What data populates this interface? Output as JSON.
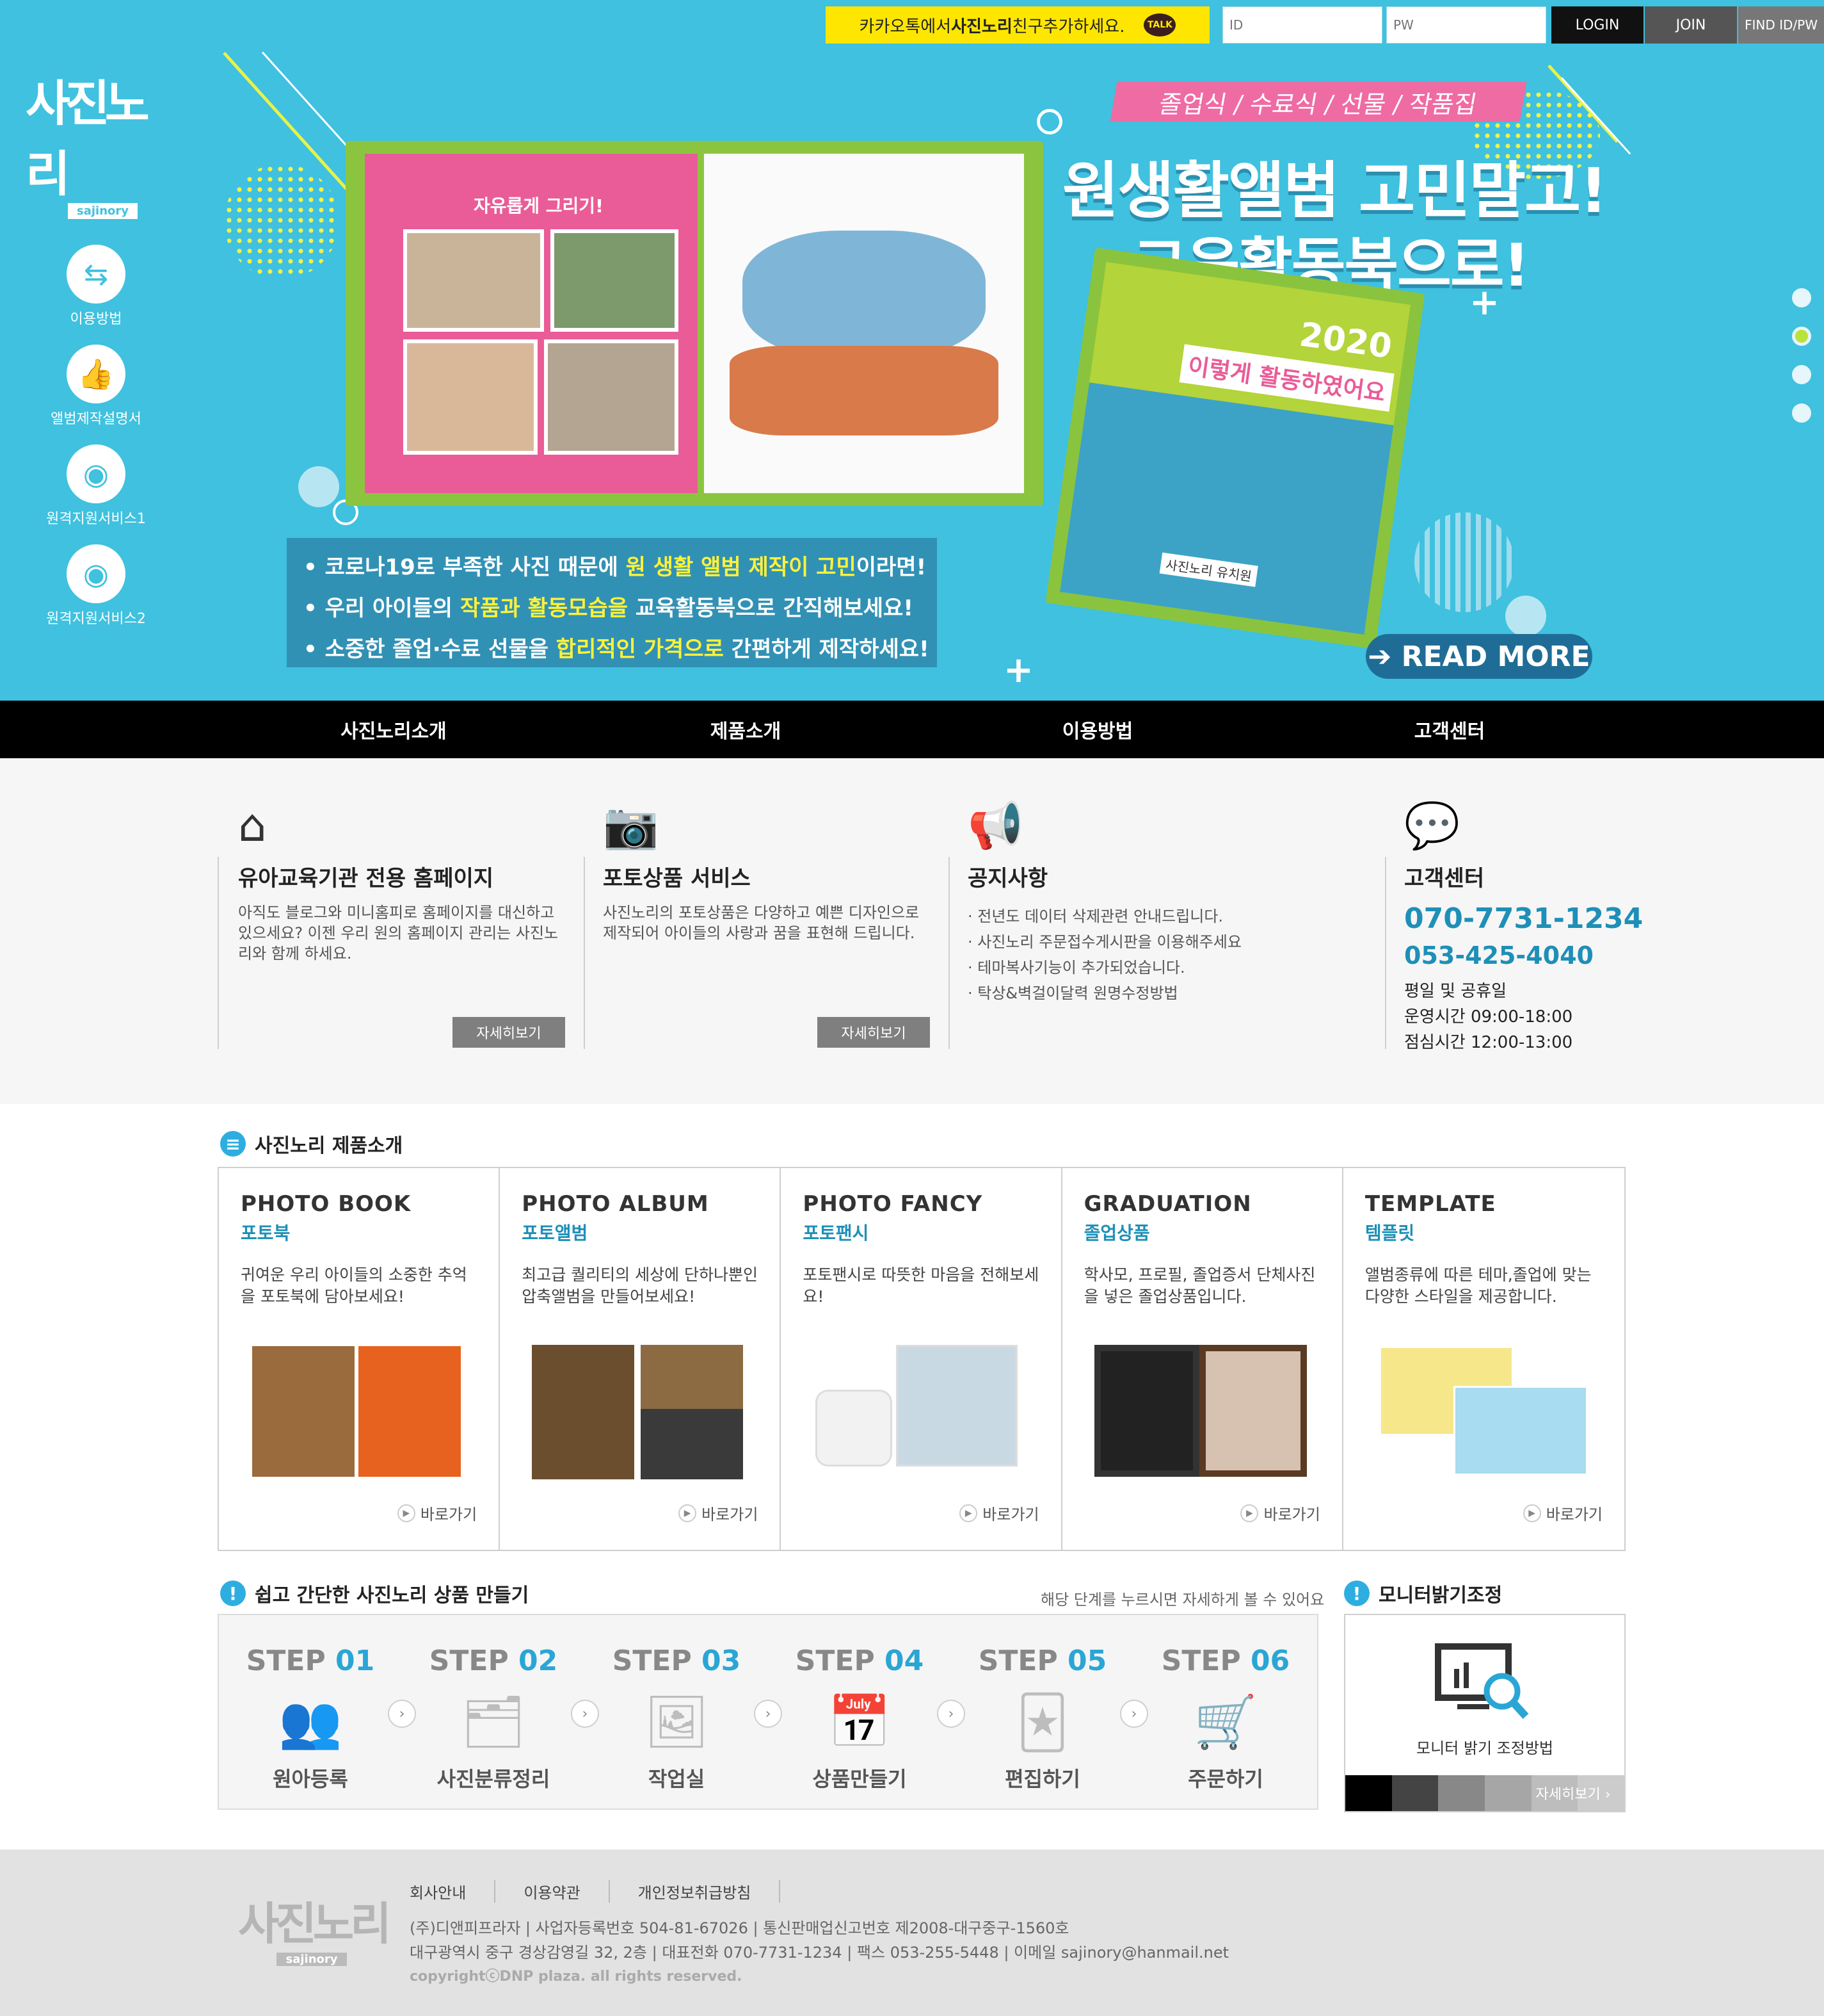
{
  "top": {
    "kakao_pre": "카카오톡에서 ",
    "kakao_brand": "사진노리",
    "kakao_post": " 친구추가하세요.",
    "kakao_badge": "TALK",
    "id_placeholder": "ID",
    "pw_placeholder": "PW",
    "login_label": "LOGIN",
    "join_label": "JOIN",
    "find_label": "FIND ID/PW"
  },
  "logo": {
    "main": "사진노리",
    "sub": "sajinory"
  },
  "sidebar": {
    "items": [
      {
        "label": "이용방법",
        "icon": "signpost-icon"
      },
      {
        "label": "앨범제작설명서",
        "icon": "thumbs-up-icon"
      },
      {
        "label": "원격지원서비스1",
        "icon": "monitor-eye-icon"
      },
      {
        "label": "원격지원서비스2",
        "icon": "monitor-eye-icon"
      }
    ]
  },
  "banner": {
    "ribbon": "졸업식 / 수료식 / 선물 / 작품집",
    "headline1": "원생활앨범 고민말고!",
    "headline2": "교육활동북으로!",
    "book_page_title": "자유롭게 그리기!",
    "product_year": "2020",
    "product_title": "이렇게 활동하였어요",
    "product_school": "사진노리 유치원",
    "bullets": [
      {
        "pre": "• 코로나19로 부족한 사진 때문에 ",
        "hl": "원 생활 앨범 제작이 고민",
        "post": "이라면!"
      },
      {
        "pre": "• 우리 아이들의 ",
        "hl": "작품과 활동모습을",
        "post": " 교육활동북으로 간직해보세요!"
      },
      {
        "pre": "• 소중한 졸업·수료 선물을 ",
        "hl": "합리적인 가격으로",
        "post": " 간편하게 제작하세요!"
      }
    ],
    "read_more": "➔ READ MORE"
  },
  "nav": [
    "사진노리소개",
    "제품소개",
    "이용방법",
    "고객센터"
  ],
  "info": {
    "homepage": {
      "title": "유아교육기관 전용 홈페이지",
      "desc": "아직도 블로그와 미니홈피로 홈페이지를 대신하고 있으세요? 이젠 우리 원의 홈페이지 관리는 사진노리와 함께 하세요.",
      "more": "자세히보기",
      "icon": "house-icon"
    },
    "photo": {
      "title": "포토상품 서비스",
      "desc": "사진노리의 포토상품은 다양하고 예쁜 디자인으로 제작되어 아이들의 사랑과 꿈을 표현해 드립니다.",
      "more": "자세히보기",
      "icon": "camera-icon"
    },
    "notice": {
      "title": "공지사항",
      "icon": "megaphone-icon",
      "items": [
        "· 전년도 데이터 삭제관련 안내드립니다.",
        "· 사진노리 주문접수게시판을 이용해주세요",
        "· 테마복사기능이 추가되었습니다.",
        "· 탁상&벽걸이달력 원명수정방법"
      ]
    },
    "support": {
      "title": "고객센터",
      "icon": "chat-bubble-icon",
      "phone1": "070-7731-1234",
      "phone2": "053-425-4040",
      "hours": [
        "평일 및 공휴일",
        "운영시간 09:00-18:00",
        "점심시간 12:00-13:00"
      ]
    }
  },
  "products": {
    "section_title": "사진노리 제품소개",
    "items": [
      {
        "en": "PHOTO BOOK",
        "ko": "포토북",
        "desc": "귀여운 우리 아이들의 소중한 추억을 포토북에 담아보세요!",
        "go": "바로가기"
      },
      {
        "en": "PHOTO ALBUM",
        "ko": "포토앨범",
        "desc": "최고급 퀄리티의 세상에 단하나뿐인 압축앨범을 만들어보세요!",
        "go": "바로가기"
      },
      {
        "en": "PHOTO FANCY",
        "ko": "포토팬시",
        "desc": "포토팬시로 따뜻한 마음을 전해보세요!",
        "go": "바로가기"
      },
      {
        "en": "GRADUATION",
        "ko": "졸업상품",
        "desc": "학사모, 프로필, 졸업증서 단체사진을 넣은 졸업상품입니다.",
        "go": "바로가기"
      },
      {
        "en": "TEMPLATE",
        "ko": "템플릿",
        "desc": "앨범종류에 따른 테마,졸업에 맞는 다양한 스타일을 제공합니다.",
        "go": "바로가기"
      }
    ]
  },
  "steps": {
    "section_title": "쉽고 간단한 사진노리 상품 만들기",
    "hint": "해당 단계를 누르시면 자세하게 볼 수 있어요",
    "items": [
      {
        "prefix": "STEP ",
        "num": "01",
        "label": "원아등록",
        "icon": "users-icon"
      },
      {
        "prefix": "STEP ",
        "num": "02",
        "label": "사진분류정리",
        "icon": "photo-stack-icon"
      },
      {
        "prefix": "STEP ",
        "num": "03",
        "label": "작업실",
        "icon": "image-edit-icon"
      },
      {
        "prefix": "STEP ",
        "num": "04",
        "label": "상품만들기",
        "icon": "calendar-photo-icon"
      },
      {
        "prefix": "STEP ",
        "num": "05",
        "label": "편집하기",
        "icon": "photo-cards-icon"
      },
      {
        "prefix": "STEP ",
        "num": "06",
        "label": "주문하기",
        "icon": "cart-icon"
      }
    ]
  },
  "monitor": {
    "section_title": "모니터밝기조정",
    "label": "모니터 밝기 조정방법",
    "more": "자세히보기 ›",
    "swatches": [
      "#000000",
      "#444444",
      "#888888",
      "#a6a6a6",
      "#bdbdbd",
      "#cccccc"
    ]
  },
  "footer": {
    "logo_main": "사진노리",
    "logo_sub": "sajinory",
    "links": [
      "회사안내",
      "이용약관",
      "개인정보취급방침"
    ],
    "addr1": "(주)디앤피프라자  |  사업자등록번호 504-81-67026  |  통신판매업신고번호 제2008-대구중구-1560호",
    "addr2": "대구광역시 중구 경상감영길 32, 2층  |  대표전화 070-7731-1234  |  팩스 053-255-5448  |  이메일 sajinory@hanmail.net",
    "copyright": "copyrightⓒDNP plaza. all rights reserved."
  },
  "colors": {
    "hero_bg": "#3fc1df",
    "accent": "#1e8fb7",
    "kakao": "#ffe600",
    "ribbon": "#ef6ba3"
  }
}
